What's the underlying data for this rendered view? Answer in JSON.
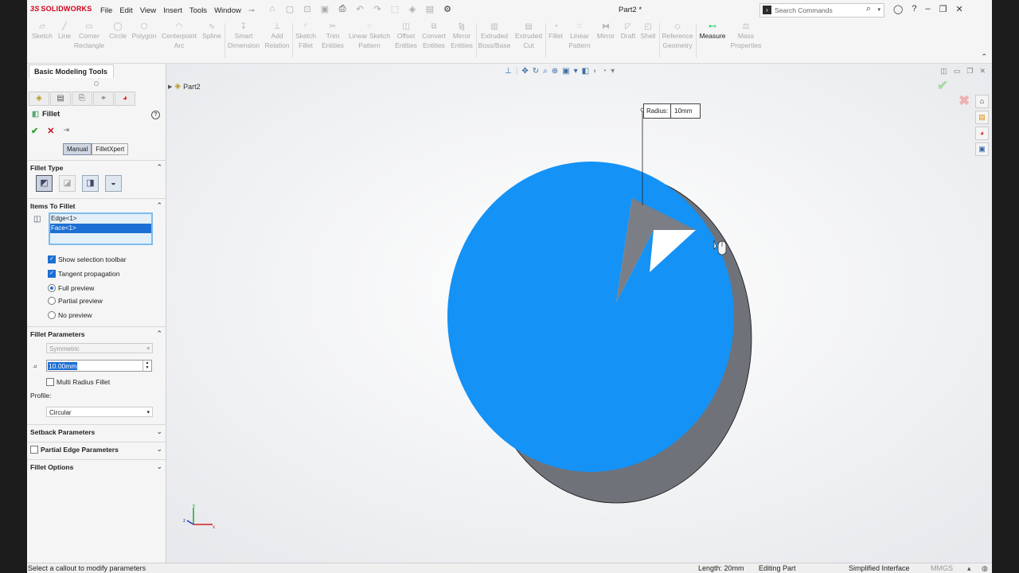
{
  "app": {
    "brand_prefix": "3S",
    "brand": "SOLIDWORKS",
    "doc_title": "Part2 *"
  },
  "menu": [
    "File",
    "Edit",
    "View",
    "Insert",
    "Tools",
    "Window"
  ],
  "search": {
    "placeholder": "Search Commands"
  },
  "commands": {
    "sketch": "Sketch",
    "line": "Line",
    "corner_rect": [
      "Corner",
      "Rectangle"
    ],
    "circle": "Circle",
    "polygon": "Polygon",
    "centerpoint_arc": [
      "Centerpoint",
      "Arc"
    ],
    "spline": "Spline",
    "smart_dim": [
      "Smart",
      "Dimension"
    ],
    "add_rel": [
      "Add",
      "Relation"
    ],
    "sketch_fillet": [
      "Sketch",
      "Fillet"
    ],
    "trim": [
      "Trim",
      "Entities"
    ],
    "linear_sketch_pattern": [
      "Linear Sketch",
      "Pattern"
    ],
    "offset": [
      "Offset",
      "Entities"
    ],
    "convert": [
      "Convert",
      "Entities"
    ],
    "mirror_ent": [
      "Mirror",
      "Entities"
    ],
    "extruded_boss": [
      "Extruded",
      "Boss/Base"
    ],
    "extruded_cut": [
      "Extruded",
      "Cut"
    ],
    "fillet": "Fillet",
    "linear_pattern": [
      "Linear",
      "Pattern"
    ],
    "mirror": "Mirror",
    "draft": "Draft",
    "shell": "Shell",
    "ref_geom": [
      "Reference",
      "Geometry"
    ],
    "measure": "Measure",
    "mass_props": [
      "Mass",
      "Properties"
    ]
  },
  "left_panel": {
    "tab": "Basic Modeling Tools",
    "feature_title": "Fillet",
    "manual": "Manual",
    "filletxpert": "FilletXpert",
    "fillet_type": "Fillet Type",
    "items_to_fillet": "Items To Fillet",
    "items": [
      "Edge<1>",
      "Face<1>"
    ],
    "show_selection_toolbar": "Show selection toolbar",
    "tangent_propagation": "Tangent propagation",
    "full_preview": "Full preview",
    "partial_preview": "Partial preview",
    "no_preview": "No preview",
    "fillet_parameters": "Fillet Parameters",
    "symmetric": "Symmetric",
    "radius_value": "10.00mm",
    "multi_radius": "Multi Radius Fillet",
    "profile_label": "Profile:",
    "profile_value": "Circular",
    "setback": "Setback Parameters",
    "partial_edge": "Partial Edge Parameters",
    "fillet_options": "Fillet Options"
  },
  "viewport": {
    "tree_item": "Part2",
    "callout_label": "Radius:",
    "callout_value": "10mm",
    "face_color": "#1592f5"
  },
  "statusbar": {
    "message": "Select a callout to modify parameters",
    "length": "Length: 20mm",
    "mode": "Editing Part",
    "interface": "Simplified Interface",
    "units": "MMGS"
  }
}
